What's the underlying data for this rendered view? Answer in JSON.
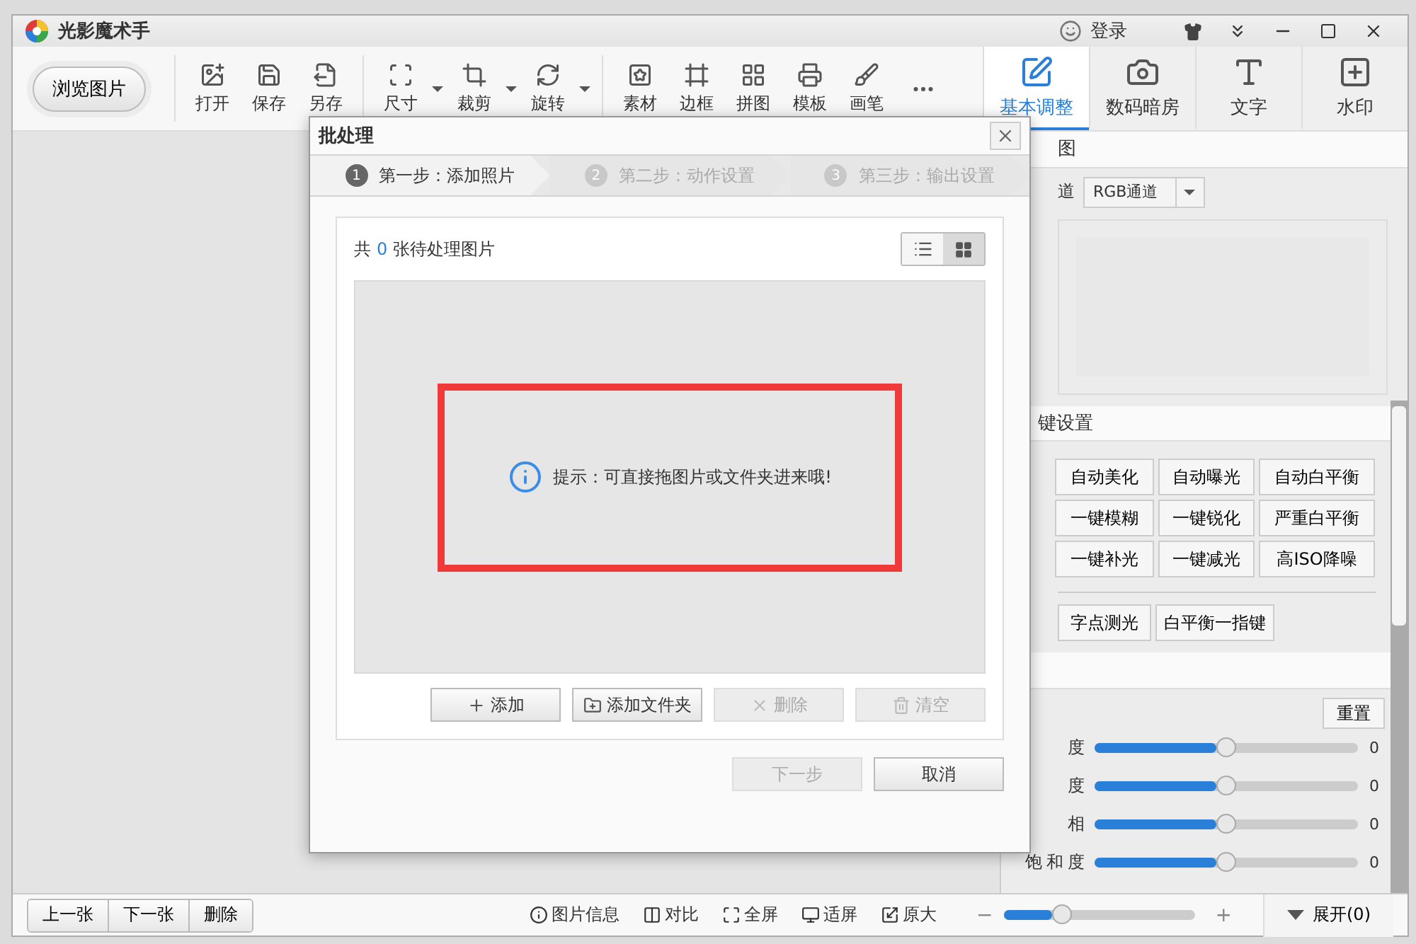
{
  "window": {
    "title": "光影魔术手",
    "login": "登录"
  },
  "toolbar": {
    "browse_button": "浏览图片",
    "tools": [
      {
        "label": "打开",
        "dropdown": false
      },
      {
        "label": "保存",
        "dropdown": false
      },
      {
        "label": "另存",
        "dropdown": false
      },
      {
        "label": "尺寸",
        "dropdown": true
      },
      {
        "label": "裁剪",
        "dropdown": true
      },
      {
        "label": "旋转",
        "dropdown": true
      },
      {
        "label": "素材",
        "dropdown": false
      },
      {
        "label": "边框",
        "dropdown": false
      },
      {
        "label": "拼图",
        "dropdown": false
      },
      {
        "label": "模板",
        "dropdown": false
      },
      {
        "label": "画笔",
        "dropdown": false
      },
      {
        "dropdown": false
      }
    ]
  },
  "panel_tabs": [
    {
      "label": "基本调整",
      "selected": true
    },
    {
      "label": "数码暗房",
      "selected": false
    },
    {
      "label": "文字",
      "selected": false
    },
    {
      "label": "水印",
      "selected": false
    }
  ],
  "right_panel": {
    "histogram": {
      "heading": "图",
      "channel_label": "道",
      "channel_select": "RGB通道"
    },
    "quick_settings": {
      "heading": "键设置",
      "buttons": [
        "自动美化",
        "自动曝光",
        "自动白平衡",
        "一键模糊",
        "一键锐化",
        "严重白平衡",
        "一键补光",
        "一键减光",
        "高ISO降噪"
      ],
      "extra_buttons": [
        "字点测光",
        "白平衡一指键"
      ]
    },
    "adjust": {
      "reset_button": "重置",
      "sliders": [
        {
          "label": "度",
          "level": 0.5,
          "reading": "0"
        },
        {
          "label": "度",
          "level": 0.5,
          "reading": "0"
        },
        {
          "label": "相",
          "level": 0.5,
          "reading": "0"
        },
        {
          "label": "饱和度",
          "level": 0.5,
          "reading": "0"
        }
      ]
    }
  },
  "bottom_bar": {
    "nav_buttons": [
      "上一张",
      "下一张",
      "删除"
    ],
    "view_tools": [
      "图片信息",
      "对比",
      "全屏",
      "适屏",
      "原大"
    ],
    "zoom": {
      "minus": "−",
      "plus": "+",
      "level": 0.3
    },
    "expand_button": "展开(0)"
  },
  "dialog": {
    "title": "批处理",
    "steps": [
      {
        "number": "1",
        "label": "第一步：添加照片",
        "selected": true
      },
      {
        "number": "2",
        "label": "第二步：动作设置",
        "selected": false
      },
      {
        "number": "3",
        "label": "第三步：输出设置",
        "selected": false
      }
    ],
    "count_prefix": "共",
    "count": "0",
    "count_suffix": "张待处理图片",
    "view_modes": [
      {
        "selected": false
      },
      {
        "selected": true
      }
    ],
    "hint": "提示：可直接拖图片或文件夹进来哦!",
    "actions": [
      {
        "label": "添加",
        "disabled": false
      },
      {
        "label": "添加文件夹",
        "disabled": false
      },
      {
        "label": "删除",
        "disabled": true
      },
      {
        "label": "清空",
        "disabled": true
      }
    ],
    "footer": [
      {
        "label": "下一步",
        "disabled": true
      },
      {
        "label": "取消",
        "disabled": false
      }
    ]
  }
}
